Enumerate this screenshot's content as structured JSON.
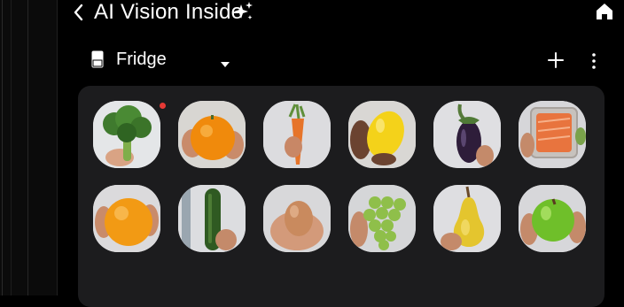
{
  "header": {
    "title": "AI Vision Inside",
    "back_icon": "chevron-left-icon",
    "sparkle_icon": "sparkle-icon",
    "home_icon": "home-icon"
  },
  "storage": {
    "selected": "Fridge",
    "icon": "fridge-icon",
    "dropdown_icon": "caret-down-icon",
    "add_icon": "plus-icon",
    "more_icon": "more-vertical-icon"
  },
  "items": [
    {
      "name": "broccoli",
      "new": true
    },
    {
      "name": "orange",
      "new": false
    },
    {
      "name": "carrot",
      "new": false
    },
    {
      "name": "lemon",
      "new": false
    },
    {
      "name": "eggplant",
      "new": false
    },
    {
      "name": "salmon",
      "new": false
    },
    {
      "name": "orange",
      "new": false
    },
    {
      "name": "cucumber",
      "new": false
    },
    {
      "name": "egg",
      "new": false
    },
    {
      "name": "grapes",
      "new": false
    },
    {
      "name": "pear",
      "new": false
    },
    {
      "name": "green-apple",
      "new": false
    }
  ],
  "colors": {
    "background": "#000000",
    "panel": "#1c1c1e",
    "tile": "#d9d9dc",
    "badge": "#e53935"
  }
}
